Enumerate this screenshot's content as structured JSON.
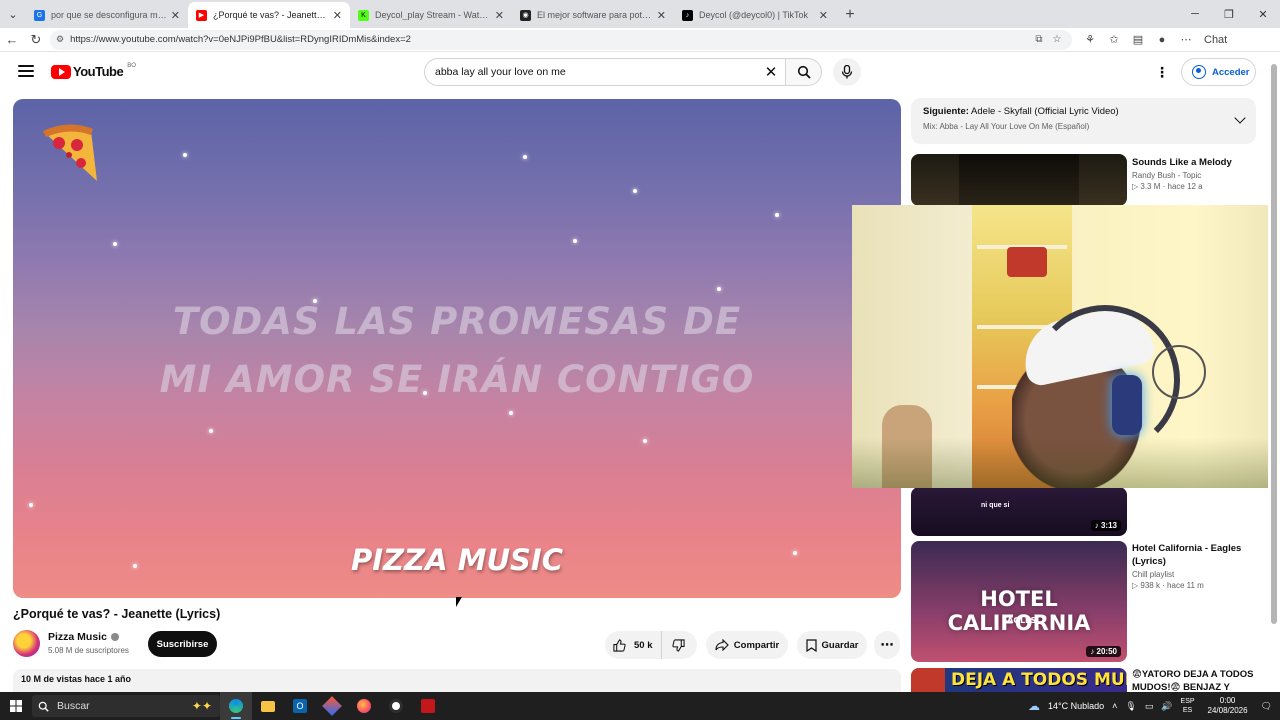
{
  "browser": {
    "tabs": [
      {
        "title": "por que se desconfigura mi tts en",
        "favicon_color": "#1a73e8",
        "active": false
      },
      {
        "title": "¿Porqué te vas? - Jeanette (Lyrics)",
        "favicon_color": "#ff0000",
        "active": true
      },
      {
        "title": "Deycol_play Stream - Watch Live o",
        "favicon_color": "#53fc18",
        "active": false
      },
      {
        "title": "El mejor software para potenciar l",
        "favicon_color": "#222222",
        "active": false
      },
      {
        "title": "Deycol (@deycol0) | TikTok",
        "favicon_color": "#010101",
        "active": false
      }
    ],
    "url": "https://www.youtube.com/watch?v=0eNJPi9PfBU&list=RDyngIRIDmMis&index=2",
    "copilot_label": "Chat"
  },
  "youtube": {
    "logo_text": "YouTube",
    "country_code": "BO",
    "search_query": "abba lay all your love on me",
    "signin_label": "Acceder"
  },
  "player": {
    "lyric_lines": [
      "TODAS LAS PROMESAS DE",
      "MI AMOR SE IRÁN CONTIGO"
    ],
    "brand": "PIZZA MUSIC"
  },
  "video": {
    "title": "¿Porqué te vas? - Jeanette (Lyrics)",
    "channel": "Pizza Music",
    "subscribers": "5.08 M de suscriptores",
    "subscribe_label": "Suscribirse",
    "likes": "50 k",
    "share_label": "Compartir",
    "save_label": "Guardar",
    "views_date": "10 M de vistas  hace 1 año"
  },
  "up_next": {
    "label": "Siguiente:",
    "title": "Adele - Skyfall (Official Lyric Video)",
    "mix": "Mix: Abba - Lay All Your Love On Me (Español)"
  },
  "related": [
    {
      "title": "Sounds Like a Melody",
      "channel": "Randy Bush - Topic",
      "meta": "▷ 3.3 M · hace 12 a",
      "duration": ""
    },
    {
      "title": "",
      "channel": "",
      "meta": "",
      "duration": "3:13",
      "caption": "ni que si"
    },
    {
      "title": "Hotel California - Eagles (Lyrics)",
      "channel": "Chill playlist",
      "meta": "▷ 938 k · hace 11 m",
      "duration": "20:50",
      "thumb_text": "HOTEL CALIFORNIA",
      "thumb_sub": "EAGLES"
    },
    {
      "title": "😨YATORO DEJA A TODOS MUDOS!😨 BENJAZ Y",
      "channel": "",
      "meta": "",
      "duration": "",
      "thumb_text": "DEJA A TODOS MUDOS"
    }
  ],
  "taskbar": {
    "search_placeholder": "Buscar",
    "weather": "14°C  Nublado",
    "lang1": "ESP",
    "lang2": "ES",
    "time": "0:00",
    "date": "24/08/2026"
  }
}
